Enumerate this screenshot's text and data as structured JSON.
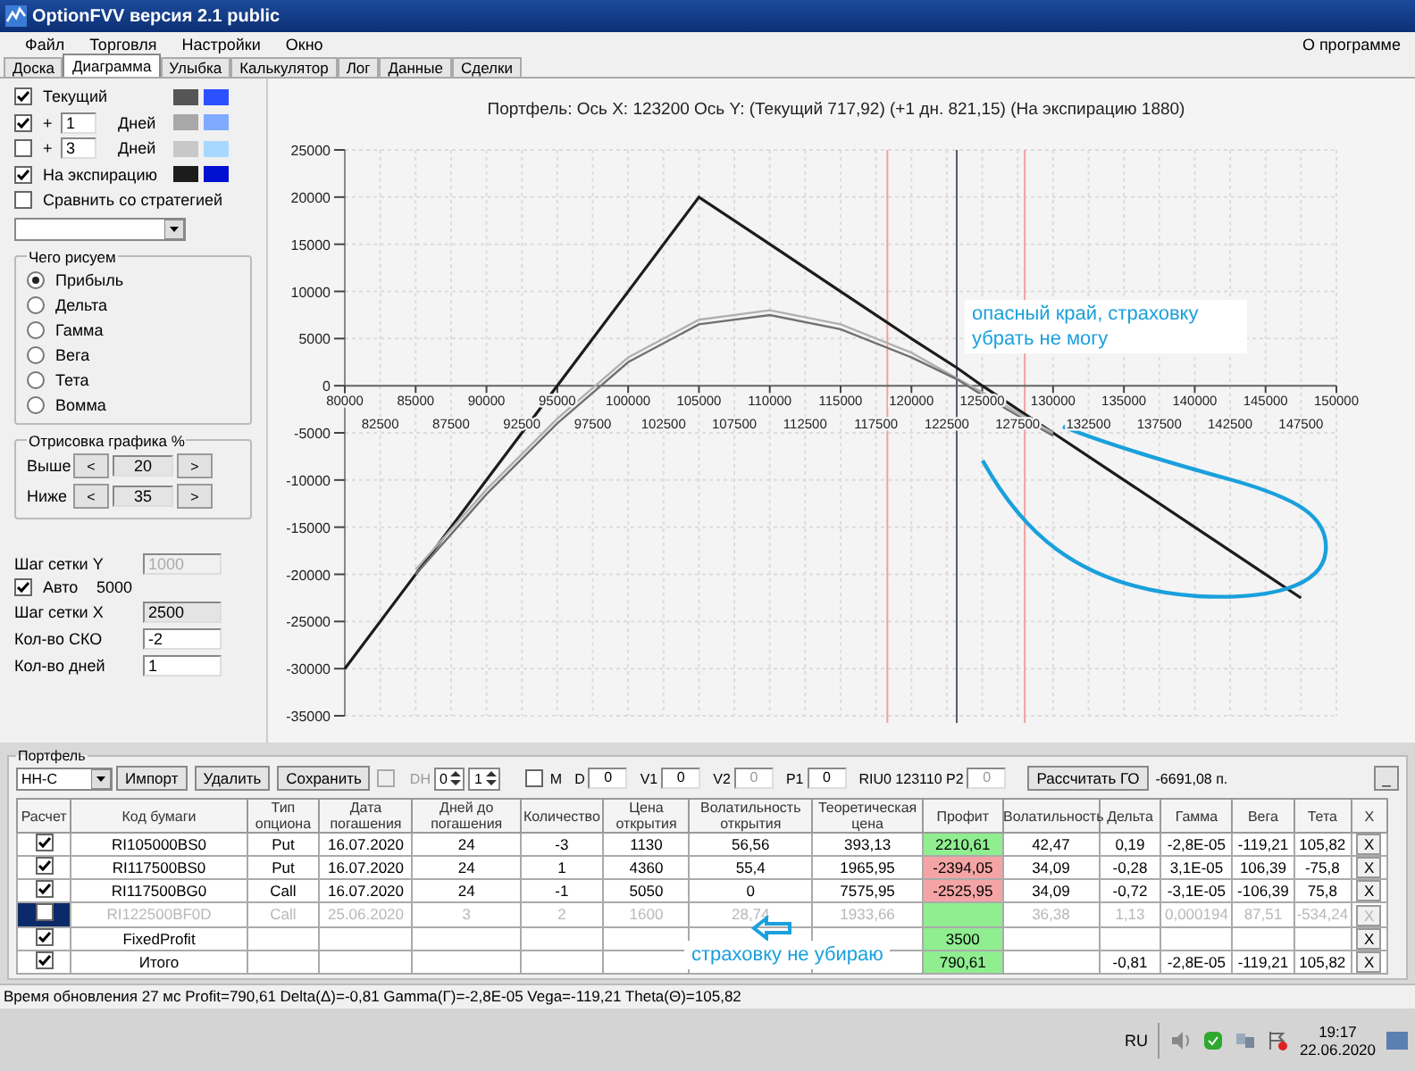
{
  "window": {
    "title": "OptionFVV версия 2.1 public"
  },
  "menu": {
    "items": [
      "Файл",
      "Торговля",
      "Настройки",
      "Окно"
    ],
    "about": "О программе"
  },
  "tabs": [
    {
      "label": "Доска",
      "selected": false
    },
    {
      "label": "Диаграмма",
      "selected": true
    },
    {
      "label": "Улыбка",
      "selected": false
    },
    {
      "label": "Калькулятор",
      "selected": false
    },
    {
      "label": "Лог",
      "selected": false
    },
    {
      "label": "Данные",
      "selected": false
    },
    {
      "label": "Сделки",
      "selected": false
    }
  ],
  "curves": [
    {
      "kind": "plain",
      "label": "Текущий",
      "checked": true,
      "swatches": [
        {
          "color": "#555555"
        },
        {
          "color": "#2a50ff"
        }
      ]
    },
    {
      "kind": "days",
      "prefix": "+",
      "days": "1",
      "label": "Дней",
      "checked": true,
      "swatches": [
        {
          "color": "#a8a8a8"
        },
        {
          "color": "#80aaff"
        }
      ]
    },
    {
      "kind": "days",
      "prefix": "+",
      "days": "3",
      "label": "Дней",
      "checked": false,
      "swatches": [
        {
          "color": "#c8c8c8"
        },
        {
          "color": "#a8d8ff"
        }
      ]
    },
    {
      "kind": "plain",
      "label": "На экспирацию",
      "checked": true,
      "swatches": [
        {
          "color": "#1c1c1c"
        },
        {
          "color": "#0010d0"
        }
      ]
    }
  ],
  "compare": {
    "label": "Сравнить со стратегией",
    "checked": false
  },
  "draw_group": {
    "title": "Чего рисуем",
    "options": [
      {
        "label": "Прибыль",
        "selected": true
      },
      {
        "label": "Дельта",
        "selected": false
      },
      {
        "label": "Гамма",
        "selected": false
      },
      {
        "label": "Вега",
        "selected": false
      },
      {
        "label": "Тета",
        "selected": false
      },
      {
        "label": "Вомма",
        "selected": false
      }
    ]
  },
  "range_group": {
    "title": "Отрисовка графика %",
    "rows": [
      {
        "label": "Выше",
        "dec": "<",
        "value": "20",
        "inc": ">"
      },
      {
        "label": "Ниже",
        "dec": "<",
        "value": "35",
        "inc": ">"
      }
    ]
  },
  "grid": {
    "y_label": "Шаг сетки Y",
    "y_value": "1000",
    "y_disabled": true,
    "auto_label": "Авто",
    "auto_checked": true,
    "auto_value": "5000",
    "x_label": "Шаг сетки X",
    "x_value": "2500",
    "sko_label": "Кол-во СКО",
    "sko_value": "-2",
    "days_label": "Кол-во дней",
    "days_value": "1"
  },
  "chart": {
    "chart_data": {
      "type": "line",
      "title": "Портфель: Ось X: 123200 Ось Y:  (Текущий 717,92)  (+1 дн. 821,15)  (На экспирацию 1880)",
      "x": [
        80000,
        85000,
        90000,
        95000,
        100000,
        105000,
        110000,
        115000,
        120000,
        123200,
        125000,
        130000,
        135000,
        140000,
        145000,
        147500
      ],
      "series": [
        {
          "color": "#1c1c1c",
          "values": [
            -30000,
            -20000,
            -10000,
            0,
            10000,
            20000,
            15000,
            10000,
            5000,
            1900,
            0,
            -5000,
            -10000,
            -15000,
            -20000,
            -22500
          ]
        },
        {
          "color": "#b0b0b0",
          "values": [
            null,
            -19500,
            -11000,
            -3500,
            3000,
            7000,
            8000,
            6500,
            3500,
            800,
            -700,
            -5000,
            null,
            null,
            null,
            null
          ]
        },
        {
          "color": "#707070",
          "values": [
            null,
            -20000,
            -11500,
            -4000,
            2500,
            6500,
            7500,
            6000,
            3000,
            700,
            -1000,
            -5300,
            null,
            null,
            null,
            null
          ]
        }
      ],
      "xlim": [
        80000,
        150000
      ],
      "ylim": [
        -35000,
        25000
      ],
      "xticks": [
        80000,
        85000,
        90000,
        95000,
        100000,
        105000,
        110000,
        115000,
        120000,
        125000,
        130000,
        135000,
        140000,
        145000,
        150000
      ],
      "yticks": [
        -35000,
        -30000,
        -25000,
        -20000,
        -15000,
        -10000,
        -5000,
        0,
        5000,
        10000,
        15000,
        20000,
        25000
      ],
      "grid": true,
      "ref_lines": [
        {
          "axis": "x",
          "value": 118300,
          "color": "#f2a0a0"
        },
        {
          "axis": "x",
          "value": 123200,
          "color": "#505a70"
        },
        {
          "axis": "x",
          "value": 128000,
          "color": "#f2a0a0"
        }
      ]
    },
    "x_labels_lower": [
      "82500",
      "87500",
      "92500",
      "97500",
      "102500",
      "107500",
      "112500",
      "117500",
      "122500",
      "127500",
      "132500",
      "137500",
      "142500",
      "147500"
    ]
  },
  "notes": [
    {
      "text": "опасный край, страховку убрать не могу"
    },
    {
      "text": "страховку не убираю"
    }
  ],
  "portfolio": {
    "title": "Портфель",
    "dropdown": "НН-С",
    "buttons": [
      "Импорт",
      "Удалить",
      "Сохранить"
    ],
    "dh": {
      "label": "DH",
      "checked": false,
      "disabled": true
    },
    "spin": [
      "0",
      "1"
    ],
    "m": {
      "label": "M",
      "checked": false
    },
    "fields": [
      {
        "label": "D",
        "value": "0",
        "disabled": false
      },
      {
        "label": "V1",
        "value": "0",
        "disabled": false
      },
      {
        "label": "V2",
        "value": "0",
        "disabled": true
      },
      {
        "label": "P1",
        "value": "0",
        "disabled": false
      },
      {
        "label": "RIU0 123110  P2",
        "value": "0",
        "disabled": true
      }
    ],
    "calc_button": "Рассчитать ГО",
    "margin": "-6691,08 п.",
    "minimize": "_"
  },
  "table": {
    "columns": [
      "Расчет",
      "Код бумаги",
      "Тип опциона",
      "Дата погашения",
      "Дней до погашения",
      "Количество",
      "Цена открытия",
      "Волатильность открытия",
      "Теоретическая цена",
      "Профит",
      "Волатильность",
      "Дельта",
      "Гамма",
      "Вега",
      "Тета",
      "X"
    ],
    "rows": [
      {
        "checked": true,
        "selected": false,
        "disabled": false,
        "color": "#90ee90",
        "cells": [
          "",
          "RI105000BS0",
          "Put",
          "16.07.2020",
          "24",
          "-3",
          "1130",
          "56,56",
          "393,13",
          "2210,61",
          "42,47",
          "0,19",
          "-2,8E-05",
          "-119,21",
          "105,82"
        ],
        "remove": "X"
      },
      {
        "checked": true,
        "selected": false,
        "disabled": false,
        "color": "#f4a4a4",
        "cells": [
          "",
          "RI117500BS0",
          "Put",
          "16.07.2020",
          "24",
          "1",
          "4360",
          "55,4",
          "1965,95",
          "-2394,05",
          "34,09",
          "-0,28",
          "3,1E-05",
          "106,39",
          "-75,8"
        ],
        "remove": "X"
      },
      {
        "checked": true,
        "selected": false,
        "disabled": false,
        "color": "#f4a4a4",
        "cells": [
          "",
          "RI117500BG0",
          "Call",
          "16.07.2020",
          "24",
          "-1",
          "5050",
          "0",
          "7575,95",
          "-2525,95",
          "34,09",
          "-0,72",
          "-3,1E-05",
          "-106,39",
          "75,8"
        ],
        "remove": "X"
      },
      {
        "checked": false,
        "selected": true,
        "disabled": true,
        "color": "#90ee90",
        "cells": [
          "",
          "RI122500BF0D",
          "Call",
          "25.06.2020",
          "3",
          "2",
          "1600",
          "28,74",
          "1933,66",
          "",
          "36,38",
          "1,13",
          "0,000194",
          "87,51",
          "-534,24"
        ],
        "remove": "X"
      },
      {
        "checked": true,
        "selected": false,
        "disabled": false,
        "color": "#90ee90",
        "cells": [
          "",
          "FixedProfit",
          "",
          "",
          "",
          "",
          "",
          "",
          "",
          "3500",
          "",
          "",
          "",
          "",
          ""
        ],
        "remove": "X"
      },
      {
        "checked": true,
        "selected": false,
        "disabled": false,
        "color": "#90ee90",
        "cells": [
          "",
          "Итого",
          "",
          "",
          "",
          "",
          "",
          "",
          "",
          "790,61",
          "",
          "-0,81",
          "-2,8E-05",
          "-119,21",
          "105,82"
        ],
        "remove": "X"
      }
    ]
  },
  "status_bar": "Время обновления 27 мс  Profit=790,61 Delta(Δ)=-0,81 Gamma(Γ)=-2,8E-05 Vega=-119,21 Theta(Θ)=105,82",
  "taskbar": {
    "language": "RU",
    "time": "19:17",
    "date": "22.06.2020"
  }
}
